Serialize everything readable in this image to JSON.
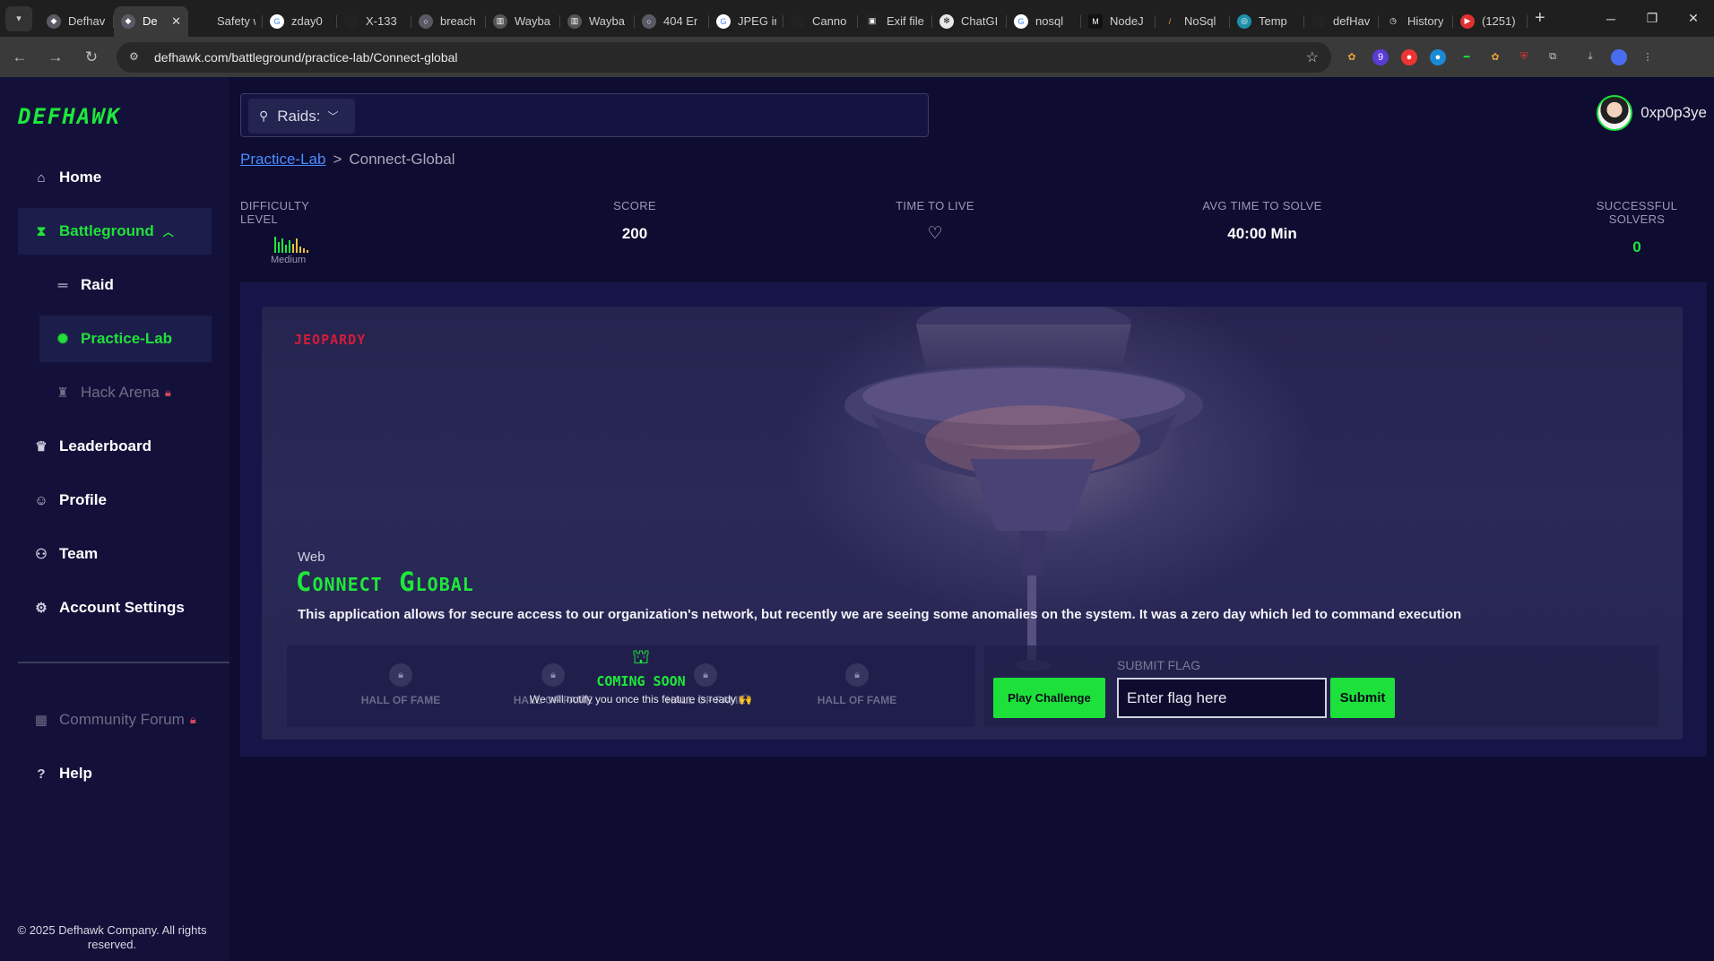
{
  "browser": {
    "tabs": [
      {
        "label": "Defhav",
        "icon": "defhawk-icon"
      },
      {
        "label": "De",
        "icon": "defhawk-icon",
        "active": true
      },
      {
        "label": "Safety wam",
        "icon": "blank-icon"
      },
      {
        "label": "zday0",
        "icon": "google-icon"
      },
      {
        "label": "X-133",
        "icon": "github-icon"
      },
      {
        "label": "breach",
        "icon": "globe-icon"
      },
      {
        "label": "Wayba",
        "icon": "archive-icon"
      },
      {
        "label": "Wayba",
        "icon": "archive-icon"
      },
      {
        "label": "404 Er",
        "icon": "globe-icon"
      },
      {
        "label": "JPEG in",
        "icon": "google-icon"
      },
      {
        "label": "Canno",
        "icon": "github-icon"
      },
      {
        "label": "Exif file",
        "icon": "exif-icon"
      },
      {
        "label": "ChatGI",
        "icon": "chatgpt-icon"
      },
      {
        "label": "nosql",
        "icon": "google-icon"
      },
      {
        "label": "NodeJ",
        "icon": "medium-icon"
      },
      {
        "label": "NoSql",
        "icon": "nosql-icon"
      },
      {
        "label": "Temp",
        "icon": "temp-icon"
      },
      {
        "label": "defHav",
        "icon": "github-icon"
      },
      {
        "label": "History",
        "icon": "history-icon"
      },
      {
        "label": "(1251)",
        "icon": "youtube-icon"
      }
    ],
    "url": "defhawk.com/battleground/practice-lab/Connect-global"
  },
  "sidebar": {
    "logo": "DEFHAWK",
    "items": {
      "home": "Home",
      "battleground": "Battleground",
      "raid": "Raid",
      "practice_lab": "Practice-Lab",
      "hack_arena": "Hack Arena",
      "leaderboard": "Leaderboard",
      "profile": "Profile",
      "team": "Team",
      "account_settings": "Account Settings",
      "community_forum": "Community Forum",
      "help": "Help"
    },
    "copyright": "© 2025 Defhawk Company. All rights reserved."
  },
  "header": {
    "search_select": "Raids:",
    "username": "0xp0p3ye"
  },
  "breadcrumb": {
    "parent": "Practice-Lab",
    "separator": ">",
    "current": "Connect-Global"
  },
  "stats": {
    "difficulty_label": "DIFFICULTY LEVEL",
    "difficulty_value": "Medium",
    "score_label": "SCORE",
    "score_value": "200",
    "ttl_label": "TIME TO LIVE",
    "avg_label": "AVG TIME TO SOLVE",
    "avg_value": "40:00 Min",
    "solvers_label": "SUCCESSFUL SOLVERS",
    "solvers_value": "0"
  },
  "challenge": {
    "type": "JEOPARDY",
    "category": "Web",
    "title": "Connect Global",
    "description": "This application allows for secure access to our organization's network, but recently we are seeing some anomalies on the system. It was a zero day which led to command execution",
    "hall_of_fame": [
      "HALL OF FAME",
      "HALL OF FAME",
      "HALL OF FAME",
      "HALL OF FAME"
    ],
    "coming_soon": "COMING SOON",
    "coming_soon_note": "We will notify you once this feature is ready 🙌",
    "play_button": "Play Challenge",
    "submit_label": "SUBMIT FLAG",
    "flag_placeholder": "Enter flag here",
    "submit_button": "Submit"
  },
  "colors": {
    "accent": "#1ee83a",
    "danger": "#d11d3a",
    "background": "#0e0c30"
  }
}
